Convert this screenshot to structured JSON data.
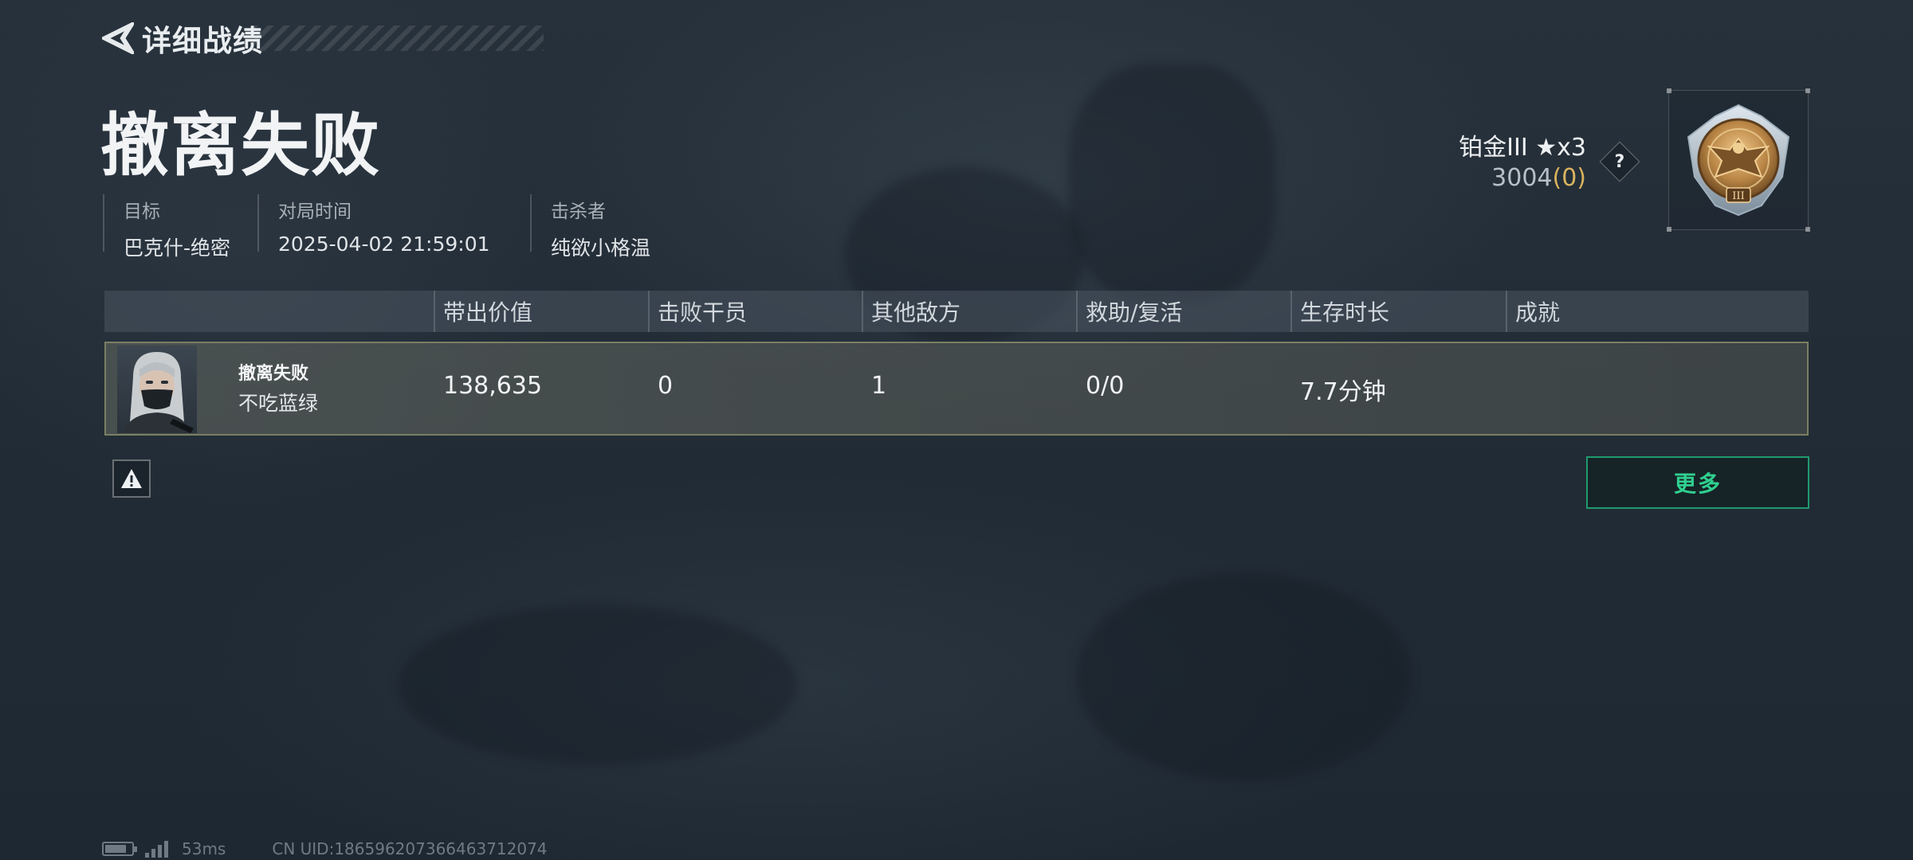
{
  "header": {
    "title": "详细战绩",
    "back_icon": "back-arrow-icon"
  },
  "result": {
    "title": "撤离失败"
  },
  "info": {
    "target_label": "目标",
    "target_value": "巴克什-绝密",
    "time_label": "对局时间",
    "time_value": "2025-04-02 21:59:01",
    "killer_label": "击杀者",
    "killer_value": "纯欲小格温"
  },
  "rank": {
    "name": "铂金III ★x3",
    "score": "3004",
    "bonus": "(0)",
    "help": "?",
    "badge_icon": "platinum-eagle-badge-icon",
    "badge_tier": "III"
  },
  "table": {
    "columns": [
      "带出价值",
      "击败干员",
      "其他敌方",
      "救助/复活",
      "生存时长",
      "成就"
    ],
    "row": {
      "status": "撤离失败",
      "player": "不吃蓝绿",
      "extract_value": "138,635",
      "operators_defeated": "0",
      "other_enemies": "1",
      "assist_revive": "0/0",
      "survival_time": "7.7分钟",
      "achievement": ""
    }
  },
  "actions": {
    "report_icon": "warning-icon",
    "more_label": "更多"
  },
  "footer": {
    "battery_level": 0.8,
    "latency": "53ms",
    "uid": "CN UID:1865962073664637120​74"
  },
  "colors": {
    "accent_green": "#2fd08f",
    "gold": "#d9b35e",
    "row_border": "#7a7f63"
  }
}
